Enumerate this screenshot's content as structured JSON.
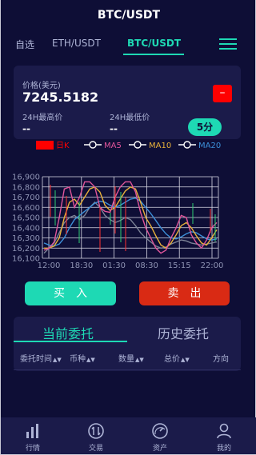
{
  "header": {
    "title": "BTC/USDT"
  },
  "tabs": [
    {
      "label": "自选"
    },
    {
      "label": "ETH/USDT"
    },
    {
      "label": "BTC/USDT"
    }
  ],
  "price_card": {
    "price_label": "价格(美元)",
    "price": "7245.5182",
    "high_label": "24H最高价",
    "high_value": "--",
    "low_label": "24H最低价",
    "low_value": "--",
    "toggle_label": "–",
    "period_label": "5分"
  },
  "legend": [
    {
      "name": "日K",
      "color": "#ff0000"
    },
    {
      "name": "MA5",
      "color": "#e0559a"
    },
    {
      "name": "MA10",
      "color": "#e8b13a"
    },
    {
      "name": "MA20",
      "color": "#3c8fd8"
    }
  ],
  "chart_data": {
    "type": "line",
    "y_ticks": [
      "16,900",
      "16,800",
      "16,700",
      "16,600",
      "16,500",
      "16,400",
      "16,300",
      "16,200",
      "16,100"
    ],
    "x_ticks": [
      "12:00",
      "18:30",
      "01:30",
      "08:30",
      "15:15",
      "22:00"
    ],
    "ylim": [
      16100,
      16900
    ],
    "grid": true,
    "series": [
      {
        "name": "MA5",
        "color": "#e0559a",
        "y": [
          16180,
          16200,
          16260,
          16500,
          16780,
          16800,
          16600,
          16700,
          16850,
          16850,
          16800,
          16600,
          16560,
          16550,
          16700,
          16800,
          16850,
          16850,
          16750,
          16550,
          16400,
          16300,
          16200,
          16150,
          16180,
          16300,
          16400,
          16520,
          16500,
          16330,
          16250,
          16200,
          16280,
          16400,
          16450
        ]
      },
      {
        "name": "MA10",
        "color": "#e8b13a",
        "y": [
          16200,
          16200,
          16220,
          16300,
          16500,
          16650,
          16680,
          16620,
          16700,
          16780,
          16800,
          16750,
          16620,
          16570,
          16600,
          16680,
          16760,
          16800,
          16780,
          16650,
          16500,
          16420,
          16320,
          16230,
          16200,
          16250,
          16330,
          16420,
          16450,
          16400,
          16320,
          16250,
          16230,
          16300,
          16380
        ]
      },
      {
        "name": "MA20",
        "color": "#3c8fd8",
        "y": [
          16250,
          16230,
          16220,
          16240,
          16300,
          16400,
          16480,
          16520,
          16560,
          16600,
          16640,
          16660,
          16650,
          16620,
          16600,
          16620,
          16650,
          16680,
          16690,
          16660,
          16600,
          16540,
          16470,
          16400,
          16340,
          16300,
          16290,
          16310,
          16340,
          16360,
          16350,
          16320,
          16290,
          16280,
          16290
        ]
      },
      {
        "name": "Price",
        "color": "#7c8296",
        "y": [
          16150,
          16200,
          16250,
          16350,
          16450,
          16500,
          16520,
          16480,
          16520,
          16600,
          16650,
          16600,
          16520,
          16480,
          16450,
          16470,
          16500,
          16480,
          16420,
          16350,
          16300,
          16260,
          16220,
          16200,
          16210,
          16240,
          16260,
          16280,
          16270,
          16250,
          16240,
          16230,
          16240,
          16250,
          16260
        ]
      }
    ]
  },
  "actions": {
    "buy_label": "买入",
    "sell_label": "卖出"
  },
  "orders": {
    "tabs": [
      {
        "label": "当前委托"
      },
      {
        "label": "历史委托"
      }
    ],
    "columns": [
      {
        "label": "委托时间",
        "sort": "▲▼"
      },
      {
        "label": "币种",
        "sort": "▲▼"
      },
      {
        "label": "数量",
        "sort": "▲▼"
      },
      {
        "label": "总价",
        "sort": "▲▼"
      },
      {
        "label": "方向",
        "sort": ""
      }
    ]
  },
  "nav": [
    {
      "label": "行情",
      "icon": "chart-bars-icon"
    },
    {
      "label": "交易",
      "icon": "swap-circle-icon"
    },
    {
      "label": "资产",
      "icon": "gauge-icon"
    },
    {
      "label": "我的",
      "icon": "user-icon"
    }
  ]
}
